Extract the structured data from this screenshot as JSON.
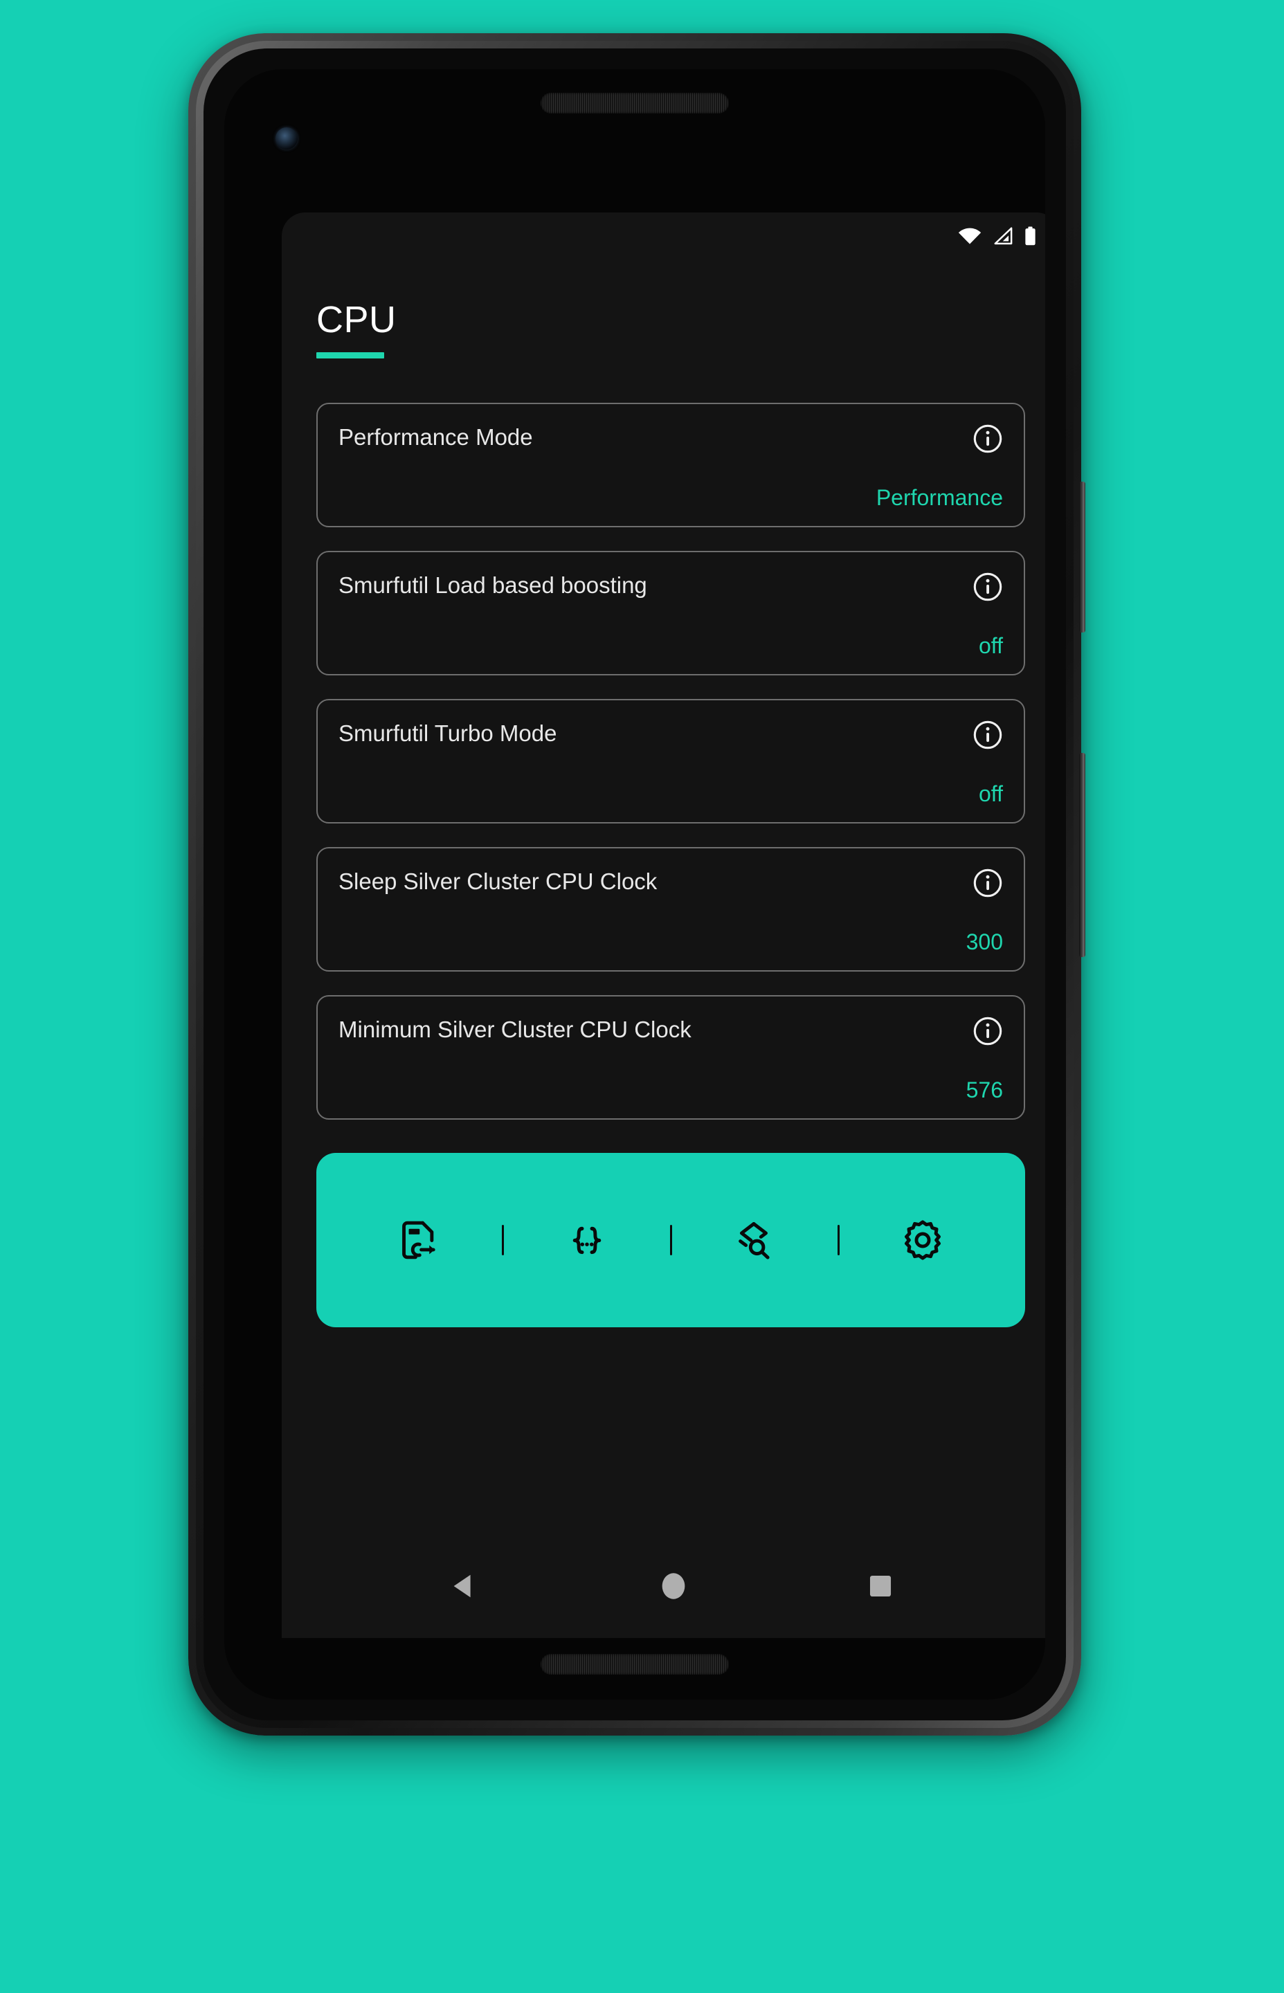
{
  "theme": {
    "background": "#15D0B4",
    "accent": "#1FD6AE",
    "toolbar_bg": "#15D0B4",
    "surface": "#141414",
    "card_bg": "#131313",
    "card_border": "#6E6E6E",
    "title_color": "#FFFFFF",
    "label_color": "#E8E8E8",
    "icon_dark": "#0A0A0A",
    "nav_icon": "#AFAFAF"
  },
  "status_bar": {
    "icons": [
      {
        "name": "wifi-icon",
        "label": "Wi-Fi"
      },
      {
        "name": "cellular-signal-icon",
        "label": "Mobile signal"
      },
      {
        "name": "battery-icon",
        "label": "Battery"
      }
    ]
  },
  "header": {
    "title": "CPU"
  },
  "cards": [
    {
      "title": "Performance Mode",
      "value": "Performance",
      "info": "info-icon"
    },
    {
      "title": "Smurfutil Load based boosting",
      "value": "off",
      "info": "info-icon"
    },
    {
      "title": "Smurfutil Turbo Mode",
      "value": "off",
      "info": "info-icon"
    },
    {
      "title": "Sleep Silver Cluster CPU Clock",
      "value": "300",
      "info": "info-icon"
    },
    {
      "title": "Minimum Silver Cluster CPU Clock",
      "value": "576",
      "info": "info-icon"
    }
  ],
  "toolbar": {
    "buttons": [
      {
        "name": "export-file-icon",
        "label": "Export profile"
      },
      {
        "name": "code-braces-icon",
        "label": "Script"
      },
      {
        "name": "inspect-search-icon",
        "label": "Inspect"
      },
      {
        "name": "gear-icon",
        "label": "Settings"
      }
    ]
  },
  "nav_bar": {
    "buttons": [
      {
        "name": "nav-back-button",
        "label": "Back"
      },
      {
        "name": "nav-home-button",
        "label": "Home"
      },
      {
        "name": "nav-recents-button",
        "label": "Recents"
      }
    ]
  },
  "device": {
    "hardware": [
      {
        "name": "power-button",
        "label": "Power"
      },
      {
        "name": "volume-rocker",
        "label": "Volume"
      }
    ]
  }
}
